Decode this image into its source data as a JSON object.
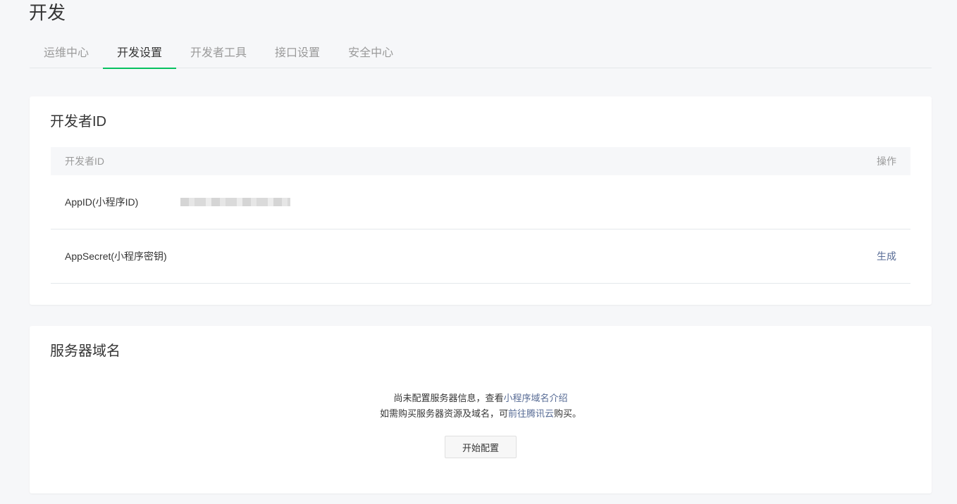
{
  "page": {
    "title": "开发"
  },
  "tabs": [
    {
      "label": "运维中心",
      "active": false
    },
    {
      "label": "开发设置",
      "active": true
    },
    {
      "label": "开发者工具",
      "active": false
    },
    {
      "label": "接口设置",
      "active": false
    },
    {
      "label": "安全中心",
      "active": false
    }
  ],
  "developer_id": {
    "title": "开发者ID",
    "table": {
      "header_name": "开发者ID",
      "header_action": "操作",
      "rows": [
        {
          "label": "AppID(小程序ID)",
          "value_masked": true
        },
        {
          "label": "AppSecret(小程序密钥)",
          "action": "生成"
        }
      ]
    }
  },
  "server_domain": {
    "title": "服务器域名",
    "message_line1_prefix": "尚未配置服务器信息，查看",
    "message_line1_link": "小程序域名介绍",
    "message_line2_prefix": "如需购买服务器资源及域名，可",
    "message_line2_link": "前往腾讯云",
    "message_line2_suffix": "购买。",
    "button_label": "开始配置"
  },
  "colors": {
    "accent": "#07c160",
    "link": "#576b95",
    "background": "#f6f7f9"
  }
}
